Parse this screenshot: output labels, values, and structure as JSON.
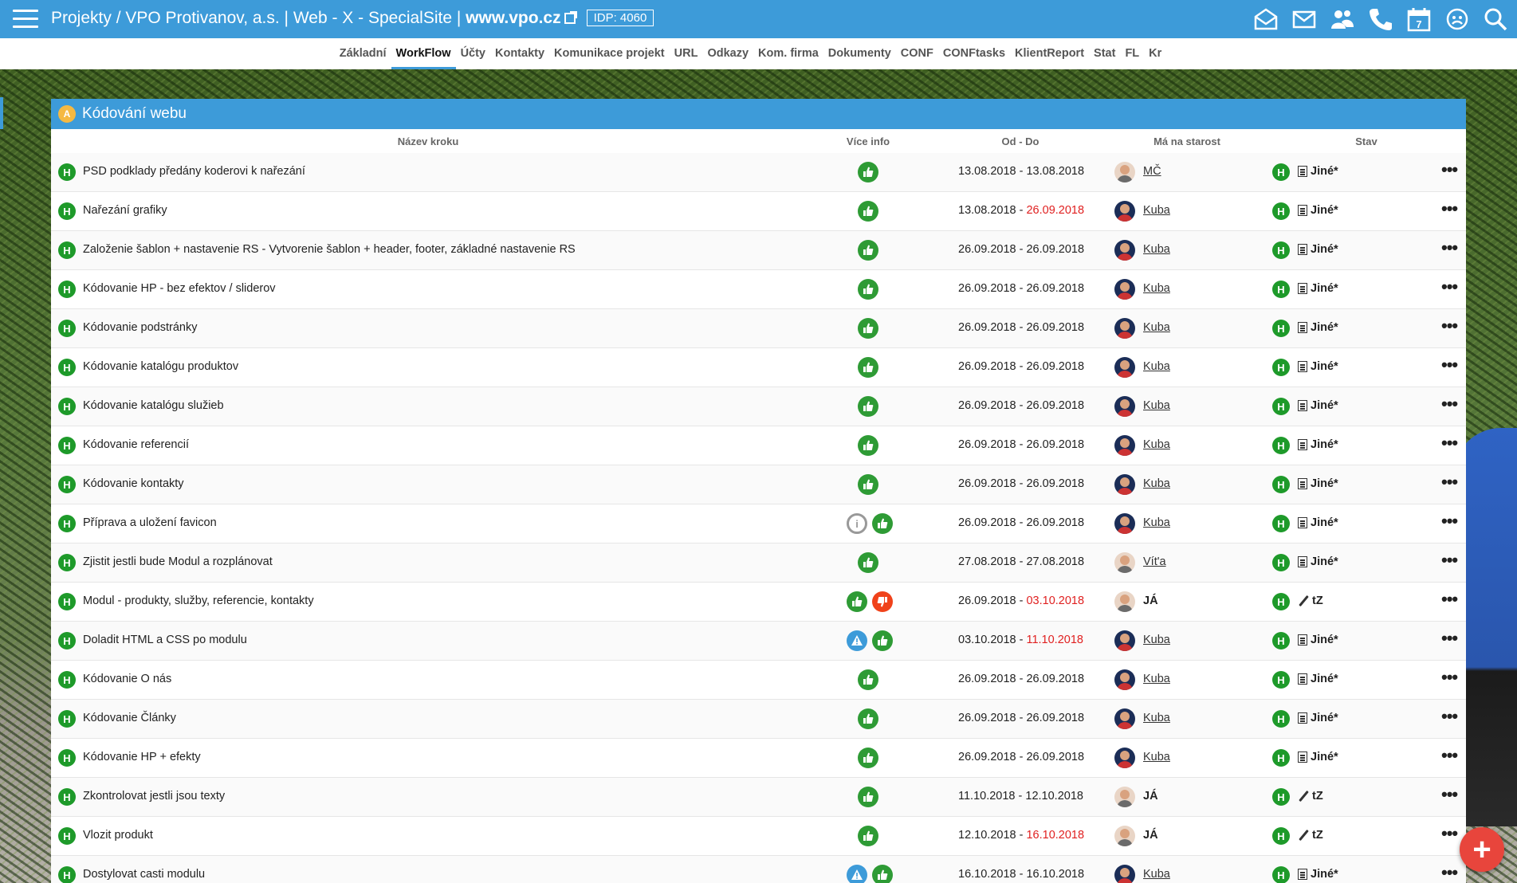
{
  "topbar": {
    "title_prefix": "Projekty / VPO Protivanov, a.s. | Web - X - SpecialSite | ",
    "domain": "www.vpo.cz",
    "idp": "IDP: 4060",
    "icons": [
      "mail-open-icon",
      "mail-icon",
      "users-icon",
      "phone-icon",
      "calendar-icon",
      "support-icon",
      "search-icon"
    ],
    "calendar_day": "7"
  },
  "subnav": {
    "tabs": [
      "Základní",
      "WorkFlow",
      "Účty",
      "Kontakty",
      "Komunikace projekt",
      "URL",
      "Odkazy",
      "Kom. firma",
      "Dokumenty",
      "CONF",
      "CONFtasks",
      "KlientReport",
      "Stat",
      "FL",
      "Kr"
    ],
    "active": "WorkFlow"
  },
  "panel": {
    "badge": "A",
    "title": "Kódování webu",
    "columns": {
      "name": "Název kroku",
      "info": "Více info",
      "dates": "Od - Do",
      "owner": "Má na starost",
      "status": "Stav"
    }
  },
  "badge_letter": "H",
  "rows": [
    {
      "name": "PSD podklady předány koderovi k nařezání",
      "icons": [
        "up"
      ],
      "from": "13.08.2018",
      "to": "13.08.2018",
      "late": false,
      "person": "MČ",
      "me": false,
      "avatar": "light",
      "status": "Jiné*",
      "status_icon": "doc"
    },
    {
      "name": "Nařezání grafiky",
      "icons": [
        "up"
      ],
      "from": "13.08.2018",
      "to": "26.09.2018",
      "late": true,
      "person": "Kuba",
      "me": false,
      "avatar": "dark",
      "status": "Jiné*",
      "status_icon": "doc"
    },
    {
      "name": "Založenie šablon + nastavenie RS - Vytvorenie šablon + header, footer, základné nastavenie RS",
      "icons": [
        "up"
      ],
      "from": "26.09.2018",
      "to": "26.09.2018",
      "late": false,
      "person": "Kuba",
      "me": false,
      "avatar": "dark",
      "status": "Jiné*",
      "status_icon": "doc"
    },
    {
      "name": "Kódovanie HP - bez efektov / sliderov",
      "icons": [
        "up"
      ],
      "from": "26.09.2018",
      "to": "26.09.2018",
      "late": false,
      "person": "Kuba",
      "me": false,
      "avatar": "dark",
      "status": "Jiné*",
      "status_icon": "doc"
    },
    {
      "name": "Kódovanie podstránky",
      "icons": [
        "up"
      ],
      "from": "26.09.2018",
      "to": "26.09.2018",
      "late": false,
      "person": "Kuba",
      "me": false,
      "avatar": "dark",
      "status": "Jiné*",
      "status_icon": "doc"
    },
    {
      "name": "Kódovanie katalógu produktov",
      "icons": [
        "up"
      ],
      "from": "26.09.2018",
      "to": "26.09.2018",
      "late": false,
      "person": "Kuba",
      "me": false,
      "avatar": "dark",
      "status": "Jiné*",
      "status_icon": "doc"
    },
    {
      "name": "Kódovanie katalógu služieb",
      "icons": [
        "up"
      ],
      "from": "26.09.2018",
      "to": "26.09.2018",
      "late": false,
      "person": "Kuba",
      "me": false,
      "avatar": "dark",
      "status": "Jiné*",
      "status_icon": "doc"
    },
    {
      "name": "Kódovanie referencií",
      "icons": [
        "up"
      ],
      "from": "26.09.2018",
      "to": "26.09.2018",
      "late": false,
      "person": "Kuba",
      "me": false,
      "avatar": "dark",
      "status": "Jiné*",
      "status_icon": "doc"
    },
    {
      "name": "Kódovanie kontakty",
      "icons": [
        "up"
      ],
      "from": "26.09.2018",
      "to": "26.09.2018",
      "late": false,
      "person": "Kuba",
      "me": false,
      "avatar": "dark",
      "status": "Jiné*",
      "status_icon": "doc"
    },
    {
      "name": "Příprava a uložení favicon",
      "icons": [
        "info",
        "up"
      ],
      "from": "26.09.2018",
      "to": "26.09.2018",
      "late": false,
      "person": "Kuba",
      "me": false,
      "avatar": "dark",
      "status": "Jiné*",
      "status_icon": "doc"
    },
    {
      "name": "Zjistit jestli bude Modul a rozplánovat",
      "icons": [
        "up"
      ],
      "from": "27.08.2018",
      "to": "27.08.2018",
      "late": false,
      "person": "Vít'a",
      "me": false,
      "avatar": "light",
      "status": "Jiné*",
      "status_icon": "doc"
    },
    {
      "name": "Modul - produkty, služby, referencie, kontakty",
      "icons": [
        "up",
        "down"
      ],
      "from": "26.09.2018",
      "to": "03.10.2018",
      "late": true,
      "person": "JÁ",
      "me": true,
      "avatar": "light",
      "status": "tZ",
      "status_icon": "pen"
    },
    {
      "name": "Doladit HTML a CSS po modulu",
      "icons": [
        "warn",
        "up"
      ],
      "from": "03.10.2018",
      "to": "11.10.2018",
      "late": true,
      "person": "Kuba",
      "me": false,
      "avatar": "dark",
      "status": "Jiné*",
      "status_icon": "doc"
    },
    {
      "name": "Kódovanie O nás",
      "icons": [
        "up"
      ],
      "from": "26.09.2018",
      "to": "26.09.2018",
      "late": false,
      "person": "Kuba",
      "me": false,
      "avatar": "dark",
      "status": "Jiné*",
      "status_icon": "doc"
    },
    {
      "name": "Kódovanie Články",
      "icons": [
        "up"
      ],
      "from": "26.09.2018",
      "to": "26.09.2018",
      "late": false,
      "person": "Kuba",
      "me": false,
      "avatar": "dark",
      "status": "Jiné*",
      "status_icon": "doc"
    },
    {
      "name": "Kódovanie HP + efekty",
      "icons": [
        "up"
      ],
      "from": "26.09.2018",
      "to": "26.09.2018",
      "late": false,
      "person": "Kuba",
      "me": false,
      "avatar": "dark",
      "status": "Jiné*",
      "status_icon": "doc"
    },
    {
      "name": "Zkontrolovat jestli jsou texty",
      "icons": [
        "up"
      ],
      "from": "11.10.2018",
      "to": "12.10.2018",
      "late": false,
      "person": "JÁ",
      "me": true,
      "avatar": "light",
      "status": "tZ",
      "status_icon": "pen"
    },
    {
      "name": "Vlozit produkt",
      "icons": [
        "up"
      ],
      "from": "12.10.2018",
      "to": "16.10.2018",
      "late": true,
      "person": "JÁ",
      "me": true,
      "avatar": "light",
      "status": "tZ",
      "status_icon": "pen"
    },
    {
      "name": "Dostylovat casti modulu",
      "icons": [
        "warn",
        "up"
      ],
      "from": "16.10.2018",
      "to": "16.10.2018",
      "late": false,
      "person": "Kuba",
      "me": false,
      "avatar": "dark",
      "status": "Jiné*",
      "status_icon": "doc"
    }
  ],
  "more_label": "•••",
  "fab_label": "+",
  "colors": {
    "accent": "#3d9bd9",
    "green": "#1e9a2a",
    "late": "#e02020",
    "fab": "#e8453c"
  }
}
